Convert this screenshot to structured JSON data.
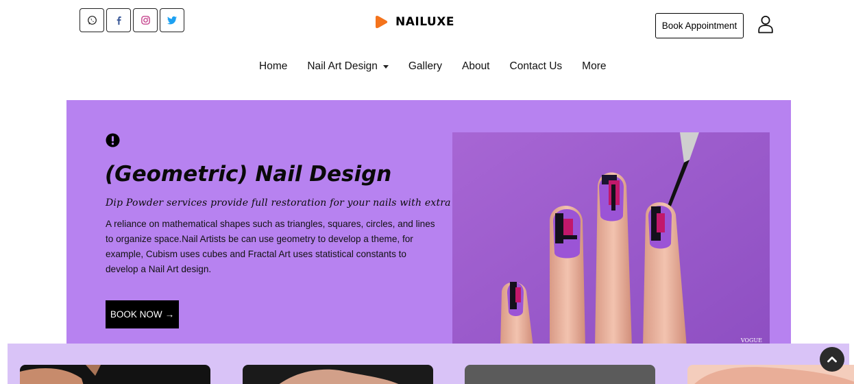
{
  "header": {
    "social": [
      {
        "name": "whatsapp-icon",
        "color": "#1f1f1f"
      },
      {
        "name": "facebook-icon",
        "color": "#3b5998"
      },
      {
        "name": "instagram-icon",
        "color": "#c13584"
      },
      {
        "name": "twitter-icon",
        "color": "#1da1f2"
      }
    ],
    "logo_text": "NAILUXE",
    "logo_color": "#f4731c",
    "book_appointment": "Book Appointment",
    "user_icon": "user-icon"
  },
  "nav": {
    "items": [
      {
        "label": "Home"
      },
      {
        "label": "Nail Art Design",
        "dropdown": true
      },
      {
        "label": "Gallery"
      },
      {
        "label": "About"
      },
      {
        "label": "Contact Us"
      },
      {
        "label": "More"
      }
    ]
  },
  "hero": {
    "background": "#b782f0",
    "icon": "exclamation-circle-icon",
    "title": "(Geometric) Nail Design",
    "tagline": "Dip Powder services provide full restoration for your nails with extra polishing.",
    "description": "A reliance on mathematical shapes such as triangles, squares, circles, and lines to organize space.Nail Artists be can use geometry to develop a theme, for example, Cubism uses cubes and Fractal Art uses statistical constants to develop a Nail Art design.",
    "cta": "BOOK NOW",
    "cta_arrow": "→",
    "image_watermark": "VOGUE"
  },
  "strip": {
    "background": "#d9c3f7",
    "cards": 4
  },
  "scroll_top_icon": "chevron-up-icon"
}
